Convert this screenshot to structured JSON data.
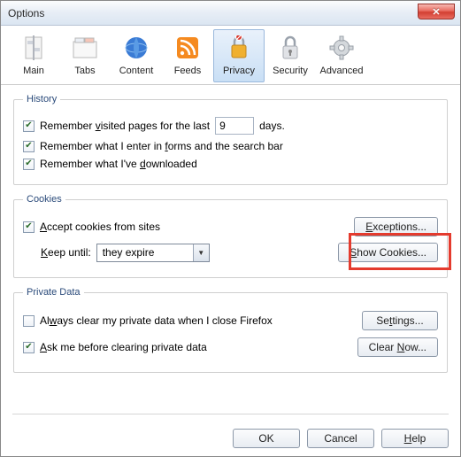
{
  "window": {
    "title": "Options"
  },
  "tabs": {
    "main": "Main",
    "tabs": "Tabs",
    "content": "Content",
    "feeds": "Feeds",
    "privacy": "Privacy",
    "security": "Security",
    "advanced": "Advanced"
  },
  "history": {
    "legend": "History",
    "remember_visited_prefix": "Remember visited pages for the last",
    "remember_visited_value": "9",
    "remember_visited_suffix": "days.",
    "remember_forms": "Remember what I enter in forms and the search bar",
    "remember_downloads": "Remember what I've downloaded"
  },
  "cookies": {
    "legend": "Cookies",
    "accept": "Accept cookies from sites",
    "keep_until_label": "Keep until:",
    "keep_until_value": "they expire",
    "exceptions_btn": "Exceptions...",
    "show_cookies_btn": "Show Cookies..."
  },
  "private_data": {
    "legend": "Private Data",
    "always_clear": "Always clear my private data when I close Firefox",
    "ask_me": "Ask me before clearing private data",
    "settings_btn": "Settings...",
    "clear_now_btn": "Clear Now..."
  },
  "footer": {
    "ok": "OK",
    "cancel": "Cancel",
    "help": "Help"
  }
}
